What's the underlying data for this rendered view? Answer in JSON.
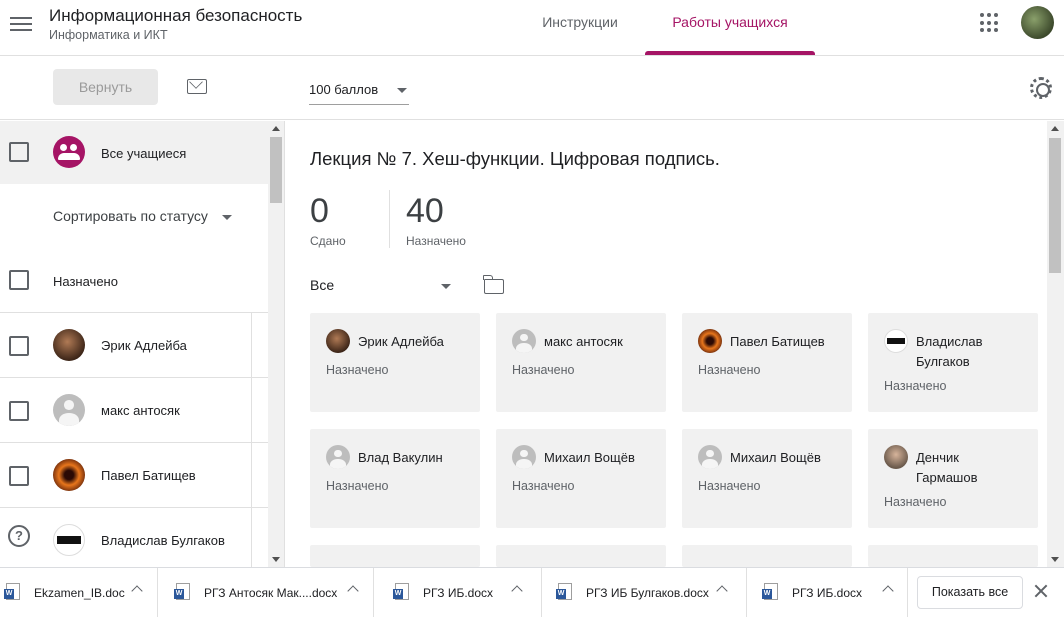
{
  "header": {
    "course_title": "Информационная безопасность",
    "course_subtitle": "Информатика и ИКТ",
    "tabs": [
      {
        "label": "Инструкции",
        "active": false
      },
      {
        "label": "Работы учащихся",
        "active": true
      }
    ],
    "accent_color": "#a51465"
  },
  "toolbar": {
    "return_label": "Вернуть",
    "points_value": "100 баллов"
  },
  "left_panel": {
    "all_students_label": "Все учащиеся",
    "sort_label": "Сортировать по статусу",
    "group_label": "Назначено",
    "students": [
      {
        "name": "Эрик Адлейба",
        "avatar": "photo"
      },
      {
        "name": "макс антосяк",
        "avatar": "generic"
      },
      {
        "name": "Павел Батищев",
        "avatar": "fire"
      },
      {
        "name": "Владислав Булгаков",
        "avatar": "bulgakov"
      }
    ]
  },
  "main": {
    "assignment_title": "Лекция № 7. Хеш-функции. Цифровая подпись.",
    "stats": [
      {
        "value": "0",
        "label": "Сдано"
      },
      {
        "value": "40",
        "label": "Назначено"
      }
    ],
    "filter_value": "Все",
    "cards": [
      {
        "name": "Эрик Адлейба",
        "status": "Назначено",
        "avatar": "photo"
      },
      {
        "name": "макс антосяк",
        "status": "Назначено",
        "avatar": "generic"
      },
      {
        "name": "Павел Батищев",
        "status": "Назначено",
        "avatar": "fire"
      },
      {
        "name": "Владислав Булгаков",
        "status": "Назначено",
        "avatar": "bulgakov"
      },
      {
        "name": "Влад Вакулин",
        "status": "Назначено",
        "avatar": "generic"
      },
      {
        "name": "Михаил Вощёв",
        "status": "Назначено",
        "avatar": "generic"
      },
      {
        "name": "Михаил Вощёв",
        "status": "Назначено",
        "avatar": "generic"
      },
      {
        "name": "Денчик Гармашов",
        "status": "Назначено",
        "avatar": "person"
      }
    ]
  },
  "downloads": {
    "items": [
      {
        "name": "Ekzamen_IB.doc"
      },
      {
        "name": "РГЗ Антосяк Мак....docx"
      },
      {
        "name": "РГЗ ИБ.docx"
      },
      {
        "name": "РГЗ ИБ Булгаков.docx"
      },
      {
        "name": "РГЗ ИБ.docx"
      }
    ],
    "show_all_label": "Показать все"
  }
}
